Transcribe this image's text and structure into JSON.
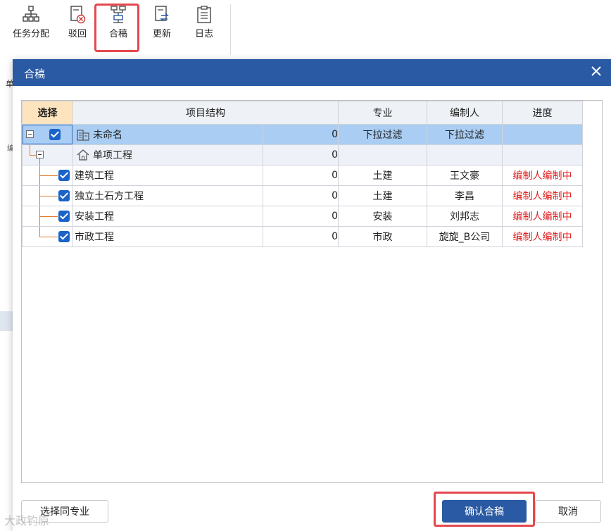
{
  "toolbar": {
    "buttons": [
      {
        "label": "任务分配",
        "icon": "org-chart-icon"
      },
      {
        "label": "驳回",
        "icon": "reject-document-icon"
      },
      {
        "label": "合稿",
        "icon": "merge-tree-icon"
      },
      {
        "label": "更新",
        "icon": "refresh-icon"
      },
      {
        "label": "日志",
        "icon": "log-clipboard-icon"
      }
    ]
  },
  "background": {
    "text1": "单",
    "text2": "编"
  },
  "dialog": {
    "title": "合稿",
    "close_icon": "close-icon",
    "columns": [
      "选择",
      "项目结构",
      "专业",
      "编制人",
      "进度"
    ],
    "rows": [
      {
        "name": "未命名",
        "icon": "building-icon",
        "value": "0",
        "major": "下拉过滤",
        "editor": "下拉过滤",
        "progress": ""
      },
      {
        "name": "单项工程",
        "icon": "home-icon",
        "value": "0",
        "major": "",
        "editor": "",
        "progress": ""
      },
      {
        "name": "建筑工程",
        "value": "0",
        "major": "土建",
        "editor": "王文豪",
        "progress": "编制人编制中"
      },
      {
        "name": "独立土石方工程",
        "value": "0",
        "major": "土建",
        "editor": "李昌",
        "progress": "编制人编制中"
      },
      {
        "name": "安装工程",
        "value": "0",
        "major": "安装",
        "editor": "刘邦志",
        "progress": "编制人编制中"
      },
      {
        "name": "市政工程",
        "value": "0",
        "major": "市政",
        "editor": "旋旋_B公司",
        "progress": "编制人编制中"
      }
    ],
    "buttons": {
      "select_same": "选择同专业",
      "confirm": "确认合稿",
      "cancel": "取消"
    }
  },
  "watermark": "大政钓原",
  "colors": {
    "primary": "#2a5aa3",
    "highlight": "#e5484d",
    "progress_red": "#e02020",
    "selected_row": "#a9cdf3"
  }
}
